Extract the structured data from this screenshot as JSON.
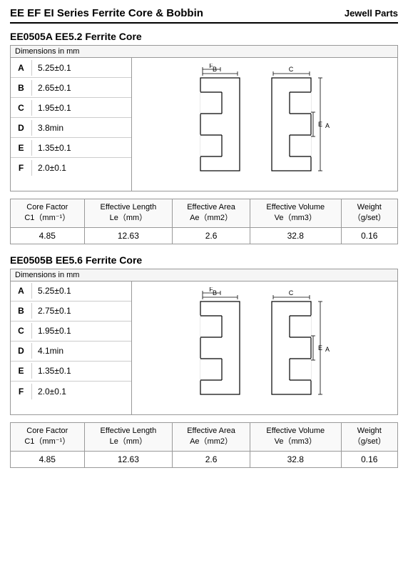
{
  "header": {
    "title": "EE EF EI Series Ferrite Core & Bobbin",
    "brand": "Jewell Parts"
  },
  "sections": [
    {
      "id": "section1",
      "title": "EE0505A EE5.2 Ferrite Core",
      "dim_header": "Dimensions in mm",
      "rows": [
        {
          "label": "A",
          "value": "5.25±0.1"
        },
        {
          "label": "B",
          "value": "2.65±0.1"
        },
        {
          "label": "C",
          "value": "1.95±0.1"
        },
        {
          "label": "D",
          "value": "3.8min"
        },
        {
          "label": "E",
          "value": "1.35±0.1"
        },
        {
          "label": "F",
          "value": "2.0±0.1"
        }
      ],
      "stats": {
        "headers": [
          "Core Factor\nC1（mm⁻¹）",
          "Effective Length\nLe（mm）",
          "Effective Area\nAe（mm2）",
          "Effective Volume\nVe（mm3）",
          "Weight\n（g/set）"
        ],
        "values": [
          "4.85",
          "12.63",
          "2.6",
          "32.8",
          "0.16"
        ]
      }
    },
    {
      "id": "section2",
      "title": "EE0505B EE5.6 Ferrite Core",
      "dim_header": "Dimensions in mm",
      "rows": [
        {
          "label": "A",
          "value": "5.25±0.1"
        },
        {
          "label": "B",
          "value": "2.75±0.1"
        },
        {
          "label": "C",
          "value": "1.95±0.1"
        },
        {
          "label": "D",
          "value": "4.1min"
        },
        {
          "label": "E",
          "value": "1.35±0.1"
        },
        {
          "label": "F",
          "value": "2.0±0.1"
        }
      ],
      "stats": {
        "headers": [
          "Core Factor\nC1（mm⁻¹）",
          "Effective Length\nLe（mm）",
          "Effective Area\nAe（mm2）",
          "Effective Volume\nVe（mm3）",
          "Weight\n（g/set）"
        ],
        "values": [
          "4.85",
          "12.63",
          "2.6",
          "32.8",
          "0.16"
        ]
      }
    }
  ]
}
